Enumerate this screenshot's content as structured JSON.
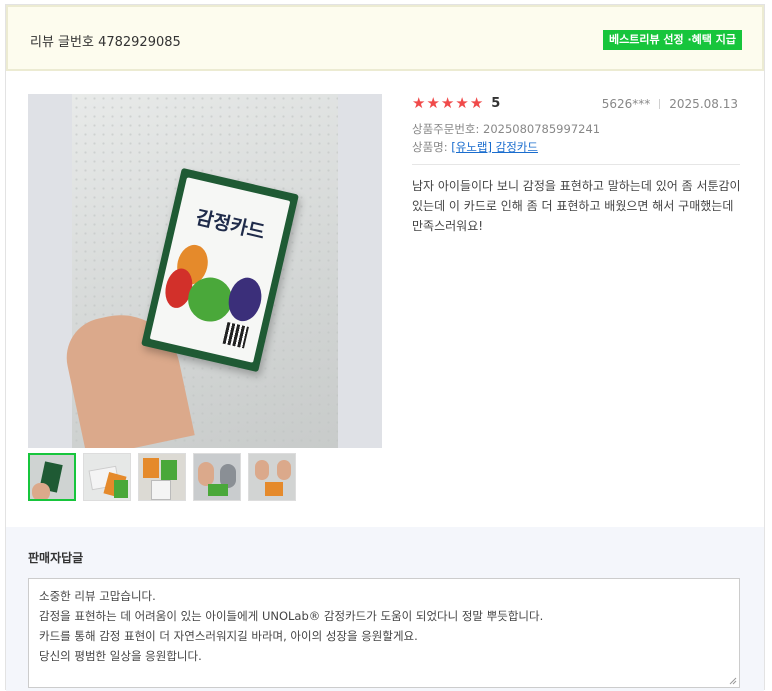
{
  "header": {
    "review_number": "리뷰 글번호 4782929085",
    "best_badge": "베스트리뷰 선정 ·혜택 지급"
  },
  "review": {
    "rating": 5,
    "rating_text": "5",
    "user": "5626***",
    "date": "2025.08.13",
    "order_label": "상품주문번호: ",
    "order_number": "2025080785997241",
    "product_label": "상품명: ",
    "product_name": "[유노랩] 감정카드",
    "text": "남자 아이들이다 보니 감정을 표현하고 말하는데 있어 좀 서툰감이 있는데 이 카드로 인해 좀 더 표현하고 배웠으면 해서 구매했는데 만족스러워요!",
    "card_title": "감정카드"
  },
  "thumbnails": {
    "count": 5,
    "active_index": 0
  },
  "seller": {
    "title": "판매자답글",
    "lines": [
      "소중한 리뷰 고맙습니다.",
      "감정을 표현하는 데 어려움이 있는 아이들에게 UNOLab® 감정카드가 도움이 되었다니 정말 뿌듯합니다.",
      "카드를 통해 감정 표현이 더 자연스러워지길 바라며, 아이의 성장을 응원할게요.",
      "당신의 평범한 일상을 응원합니다."
    ]
  },
  "colors": {
    "accent_green": "#17c53c",
    "star_red": "#f04a4a",
    "link_blue": "#1a6dce"
  }
}
